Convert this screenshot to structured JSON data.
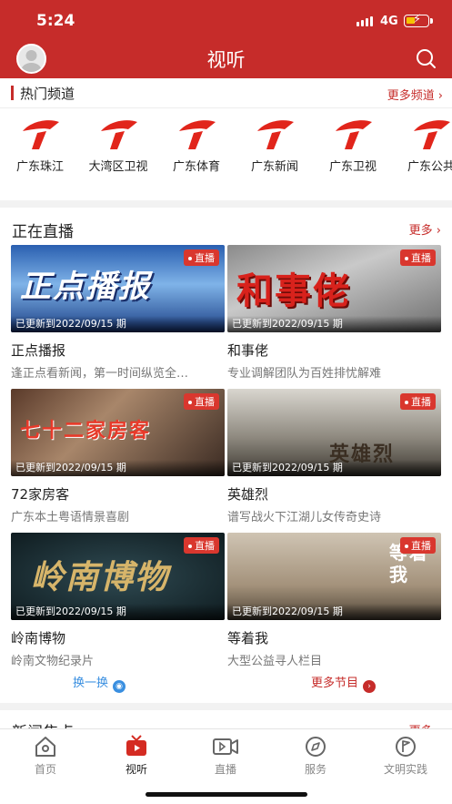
{
  "status": {
    "time": "5:24",
    "network": "4G"
  },
  "header": {
    "title": "视听"
  },
  "hot_channels": {
    "title": "热门频道",
    "more": "更多频道",
    "items": [
      {
        "label": "广东珠江",
        "icon": "gdtv-logo"
      },
      {
        "label": "大湾区卫视",
        "icon": "gdtv-logo"
      },
      {
        "label": "广东体育",
        "icon": "gdtv-logo"
      },
      {
        "label": "广东新闻",
        "icon": "gdtv-logo"
      },
      {
        "label": "广东卫视",
        "icon": "gdtv-logo"
      },
      {
        "label": "广东公共",
        "icon": "gdtv-logo"
      }
    ]
  },
  "live": {
    "title": "正在直播",
    "more": "更多",
    "badge": "直播",
    "cards": [
      {
        "title": "正点播报",
        "desc": "逢正点看新闻，第一时间纵览全…",
        "updated": "已更新到2022/09/15 期",
        "art": "正点播报"
      },
      {
        "title": "和事佬",
        "desc": "专业调解团队为百姓排忧解难",
        "updated": "已更新到2022/09/15 期",
        "art": "和事佬"
      },
      {
        "title": "72家房客",
        "desc": "广东本土粤语情景喜剧",
        "updated": "已更新到2022/09/15 期",
        "art": "七十二家房客"
      },
      {
        "title": "英雄烈",
        "desc": "谱写战火下江湖儿女传奇史诗",
        "updated": "已更新到2022/09/15 期",
        "art": "英雄烈"
      },
      {
        "title": "岭南博物",
        "desc": "岭南文物纪录片",
        "updated": "已更新到2022/09/15 期",
        "art": "岭南博物"
      },
      {
        "title": "等着我",
        "desc": "大型公益寻人栏目",
        "updated": "已更新到2022/09/15 期",
        "art": "等着我"
      }
    ],
    "shuffle": "换一换",
    "more_programs": "更多节目"
  },
  "news": {
    "title": "新闻焦点",
    "more": "更多"
  },
  "tabbar": [
    {
      "label": "首页",
      "icon": "home-icon",
      "active": false
    },
    {
      "label": "视听",
      "icon": "tv-icon",
      "active": true
    },
    {
      "label": "直播",
      "icon": "video-camera-icon",
      "active": false
    },
    {
      "label": "服务",
      "icon": "compass-icon",
      "active": false
    },
    {
      "label": "文明实践",
      "icon": "flag-icon",
      "active": false
    }
  ],
  "colors": {
    "brand": "#c62c2a",
    "link_blue": "#3a8fe0"
  }
}
